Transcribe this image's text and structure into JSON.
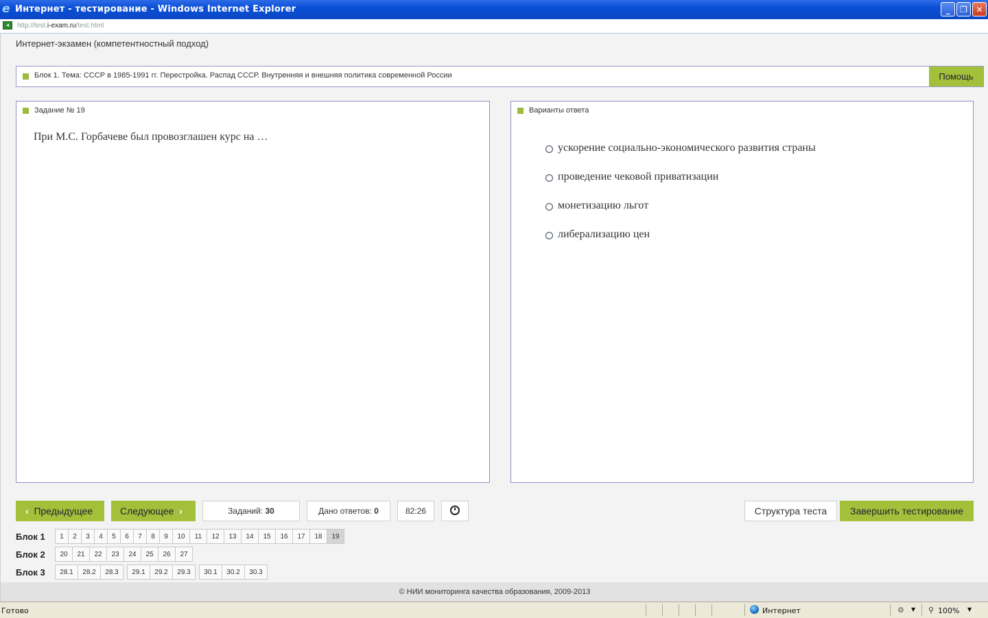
{
  "window": {
    "title": "Интернет - тестирование - Windows Internet Explorer",
    "minimize": "_",
    "restore": "❐",
    "close": "✕"
  },
  "address": {
    "prefix": "http://test.",
    "domain": "i-exam.ru",
    "suffix": "/test.html"
  },
  "header": {
    "title": "Интернет-экзамен (компетентностный подход)"
  },
  "block_bar": {
    "text": "Блок 1. Тема: СССР в 1985-1991 гг. Перестройка. Распад СССР. Внутренняя и внешняя политика современной России",
    "help_label": "Помощь"
  },
  "task": {
    "heading": "Задание № 19",
    "question": "При М.С. Горбачеве был провозглашен курс на …"
  },
  "answers_panel": {
    "heading": "Варианты ответа",
    "options": [
      "ускорение социально-экономического развития страны",
      "проведение чековой приватизации",
      "монетизацию льгот",
      "либерализацию цен"
    ]
  },
  "controls": {
    "prev_label": "Предыдущее",
    "next_label": "Следующее",
    "tasks_label": "Заданий:",
    "tasks_count": "30",
    "answered_label": "Дано ответов:",
    "answered_count": "0",
    "timer": "82:26",
    "structure_label": "Структура теста",
    "finish_label": "Завершить тестирование"
  },
  "blocks": [
    {
      "label": "Блок 1",
      "groups": [
        [
          "1",
          "2",
          "3",
          "4",
          "5",
          "6",
          "7",
          "8",
          "9",
          "10",
          "11",
          "12",
          "13",
          "14",
          "15",
          "16",
          "17",
          "18",
          "19"
        ]
      ],
      "active": "19"
    },
    {
      "label": "Блок 2",
      "groups": [
        [
          "20",
          "21",
          "22",
          "23",
          "24",
          "25",
          "26",
          "27"
        ]
      ],
      "active": ""
    },
    {
      "label": "Блок 3",
      "groups": [
        [
          "28.1",
          "28.2",
          "28.3"
        ],
        [
          "29.1",
          "29.2",
          "29.3"
        ],
        [
          "30.1",
          "30.2",
          "30.3"
        ]
      ],
      "active": ""
    }
  ],
  "footer": {
    "text": "© НИИ мониторинга качества образования, 2009-2013"
  },
  "status": {
    "ready": "Готово",
    "zone": "Интернет",
    "zoom": "100%"
  }
}
